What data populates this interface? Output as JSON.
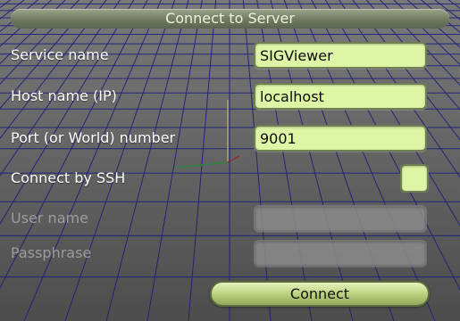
{
  "dialog": {
    "title": "Connect to Server",
    "connect_label": "Connect",
    "colors": {
      "accent": "#dff5a6",
      "border": "#6f7f52",
      "grid": "#1a1a9a"
    }
  },
  "fields": {
    "service": {
      "label": "Service name",
      "value": "SIGViewer"
    },
    "host": {
      "label": "Host name (IP)",
      "value": "localhost"
    },
    "port": {
      "label": "Port (or World) number",
      "value": "9001"
    },
    "ssh": {
      "label": "Connect by SSH",
      "checked": false
    },
    "user": {
      "label": "User name",
      "value": ""
    },
    "passphrase": {
      "label": "Passphrase",
      "value": ""
    }
  }
}
